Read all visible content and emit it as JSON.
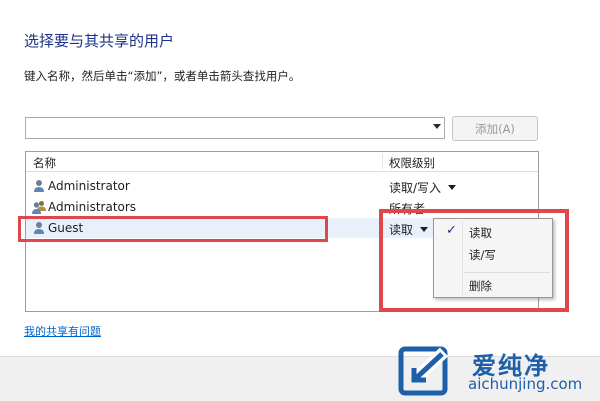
{
  "dialog": {
    "title": "选择要与其共享的用户",
    "instruction": "键入名称，然后单击“添加”，或者单击箭头查找用户。",
    "add_button": "添加(A)",
    "name_input_value": ""
  },
  "list": {
    "columns": [
      "名称",
      "权限级别"
    ],
    "rows": [
      {
        "name": "Administrator",
        "permission": "读取/写入",
        "icon": "user-icon",
        "has_dropdown": true
      },
      {
        "name": "Administrators",
        "permission": "所有者",
        "icon": "group-icon",
        "has_dropdown": false
      },
      {
        "name": "Guest",
        "permission": "读取",
        "icon": "user-icon",
        "has_dropdown": true,
        "selected": true
      }
    ]
  },
  "permission_menu": {
    "items": [
      {
        "label": "读取",
        "checked": true
      },
      {
        "label": "读/写",
        "checked": false
      },
      {
        "label": "删除",
        "checked": false
      }
    ]
  },
  "help_link": "我的共享有问题",
  "watermark": {
    "brand": "爱纯净",
    "url": "aichunjing.com"
  },
  "colors": {
    "title": "#1e3287",
    "highlight": "#e0474c",
    "link": "#0066cc",
    "watermark": "#1d5fa8"
  }
}
